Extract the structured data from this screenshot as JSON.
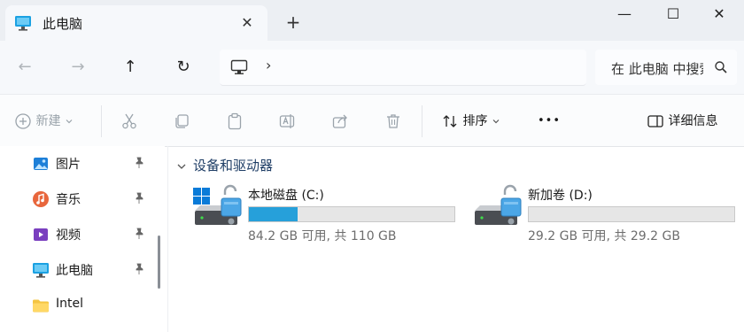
{
  "tab": {
    "title": "此电脑",
    "close_glyph": "✕"
  },
  "newtab_glyph": "+",
  "window_controls": {
    "minimize": "—",
    "maximize": "☐",
    "close": "✕"
  },
  "nav": {
    "back": "←",
    "forward": "→",
    "up": "↑",
    "refresh": "↻"
  },
  "address": {
    "chevron": "›"
  },
  "search": {
    "placeholder": "在 此电脑 中搜索"
  },
  "toolbar": {
    "new_label": "新建",
    "sort_label": "排序",
    "more_label": "•••",
    "details_label": "详细信息"
  },
  "sidebar": {
    "items": [
      {
        "label": "图片",
        "icon": "pictures-icon"
      },
      {
        "label": "音乐",
        "icon": "music-icon"
      },
      {
        "label": "视频",
        "icon": "videos-icon"
      },
      {
        "label": "此电脑",
        "icon": "this-pc-icon"
      },
      {
        "label": "Intel",
        "icon": "folder-icon"
      }
    ]
  },
  "group": {
    "title": "设备和驱动器"
  },
  "drives": [
    {
      "name": "本地磁盘 (C:)",
      "free_text": "84.2 GB 可用, 共 110 GB",
      "used_fraction": 0.235
    },
    {
      "name": "新加卷 (D:)",
      "free_text": "29.2 GB 可用, 共 29.2 GB",
      "used_fraction": 0.0
    }
  ],
  "colors": {
    "accent": "#26a0da",
    "bar_bg": "#e6e6e6",
    "header_text": "#1f3e66"
  }
}
